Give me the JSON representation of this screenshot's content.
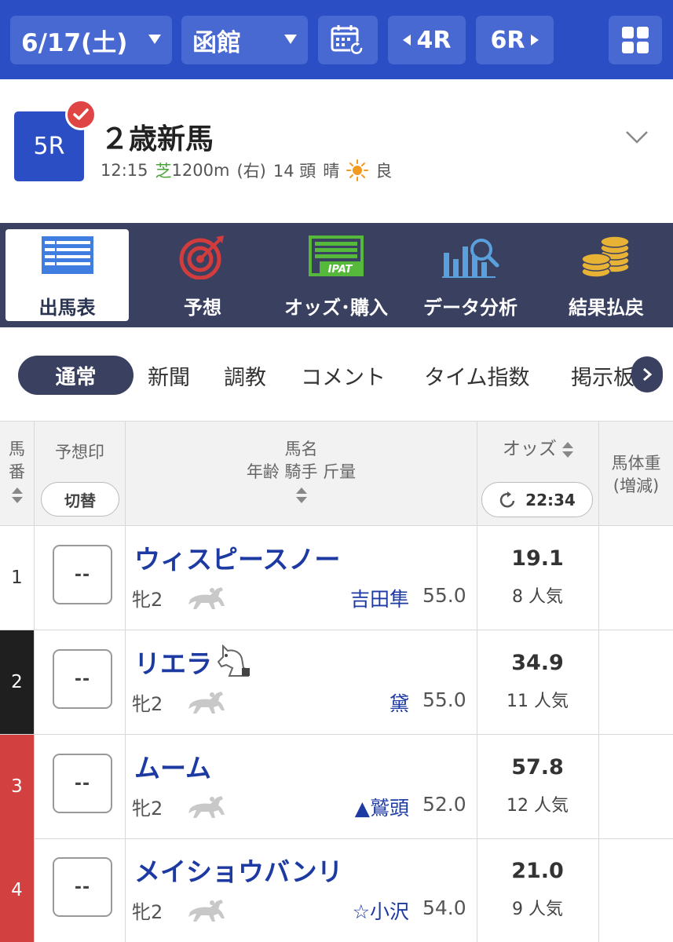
{
  "topbar": {
    "date": "6/17(土)",
    "venue": "函館",
    "prev_race": "4R",
    "next_race": "6R"
  },
  "race": {
    "number": "5R",
    "title": "２歳新馬",
    "time": "12:15",
    "surface": "芝",
    "distance": "1200m",
    "direction": "(右)",
    "runners": "14 頭",
    "weather": "晴",
    "condition": "良"
  },
  "nav": [
    {
      "label": "出馬表",
      "icon": "entry-table-icon"
    },
    {
      "label": "予想",
      "icon": "target-icon"
    },
    {
      "label": "オッズ･購入",
      "icon": "ipat-icon"
    },
    {
      "label": "データ分析",
      "icon": "data-analysis-icon"
    },
    {
      "label": "結果払戻",
      "icon": "coins-icon"
    }
  ],
  "subtabs": [
    "通常",
    "新聞",
    "調教",
    "コメント",
    "タイム指数",
    "掲示板"
  ],
  "table_header": {
    "num": "馬番",
    "mark": "予想印",
    "toggle": "切替",
    "name": "馬名",
    "name_sub": "年齢 騎手 斤量",
    "odds": "オッズ",
    "updated": "22:34",
    "weight": "馬体重",
    "weight_sub": "(増減)"
  },
  "colors": {
    "brand_blue": "#2b4ec4",
    "nav_dark": "#3a4060",
    "gate_2": "#1f1f1f",
    "gate_3_4": "#d2413f"
  },
  "horses": [
    {
      "num": "1",
      "mark": "--",
      "name": "ウィスピースノー",
      "sex_age": "牝2",
      "jockey": "吉田隼",
      "weight": "55.0",
      "odds": "19.1",
      "popularity": "8 人気"
    },
    {
      "num": "2",
      "mark": "--",
      "name": "リエラ",
      "sex_age": "牝2",
      "jockey": "黛",
      "weight": "55.0",
      "odds": "34.9",
      "popularity": "11 人気"
    },
    {
      "num": "3",
      "mark": "--",
      "name": "ムーム",
      "sex_age": "牝2",
      "jockey": "▲鷲頭",
      "weight": "52.0",
      "odds": "57.8",
      "popularity": "12 人気"
    },
    {
      "num": "4",
      "mark": "--",
      "name": "メイショウバンリ",
      "sex_age": "牝2",
      "jockey": "☆小沢",
      "weight": "54.0",
      "odds": "21.0",
      "popularity": "9 人気"
    }
  ]
}
